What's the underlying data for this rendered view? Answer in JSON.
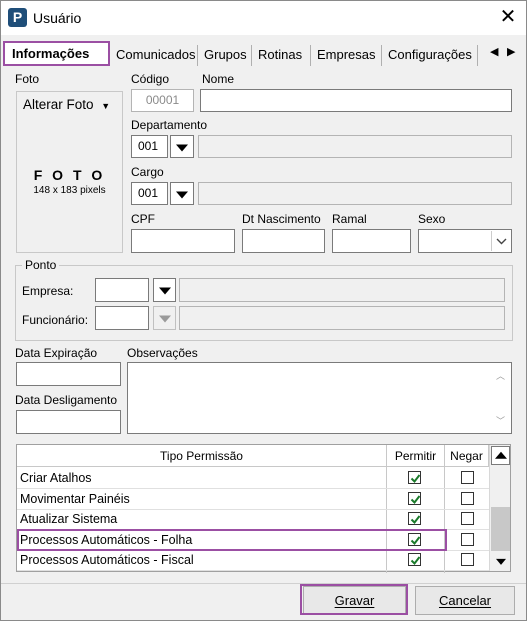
{
  "window": {
    "title": "Usuário",
    "icon": "P"
  },
  "tabs": [
    {
      "label": "Informações",
      "active": true
    },
    {
      "label": "Comunicados"
    },
    {
      "label": "Grupos"
    },
    {
      "label": "Rotinas"
    },
    {
      "label": "Empresas"
    },
    {
      "label": "Configurações"
    }
  ],
  "photo": {
    "section_label": "Foto",
    "button_label": "Alterar Foto",
    "placeholder_title": "F O T O",
    "placeholder_size": "148 x 183 pixels"
  },
  "fields": {
    "codigo_label": "Código",
    "codigo_value": "00001",
    "nome_label": "Nome",
    "nome_value": "",
    "departamento_label": "Departamento",
    "departamento_value": "001",
    "cargo_label": "Cargo",
    "cargo_value": "001",
    "cpf_label": "CPF",
    "nascimento_label": "Dt Nascimento",
    "ramal_label": "Ramal",
    "sexo_label": "Sexo"
  },
  "ponto": {
    "title": "Ponto",
    "empresa_label": "Empresa:",
    "funcionario_label": "Funcionário:"
  },
  "extra": {
    "expiracao_label": "Data Expiração",
    "desligamento_label": "Data Desligamento",
    "observacoes_label": "Observações"
  },
  "permissions": {
    "col_tipo": "Tipo Permissão",
    "col_permitir": "Permitir",
    "col_negar": "Negar",
    "rows": [
      {
        "name": "Criar Atalhos",
        "permitir": true,
        "negar": false
      },
      {
        "name": "Movimentar Painéis",
        "permitir": true,
        "negar": false
      },
      {
        "name": "Atualizar Sistema",
        "permitir": true,
        "negar": false
      },
      {
        "name": "Processos Automáticos - Folha",
        "permitir": true,
        "negar": false,
        "highlighted": true
      },
      {
        "name": "Processos Automáticos - Fiscal",
        "permitir": true,
        "negar": false
      }
    ]
  },
  "buttons": {
    "gravar": "Gravar",
    "cancelar": "Cancelar"
  },
  "colors": {
    "highlight": "#9b4fa3",
    "check": "#1a7a2a"
  },
  "icons": {
    "close": "close-icon",
    "tab_left": "chevron-left-icon",
    "tab_right": "chevron-right-icon"
  }
}
